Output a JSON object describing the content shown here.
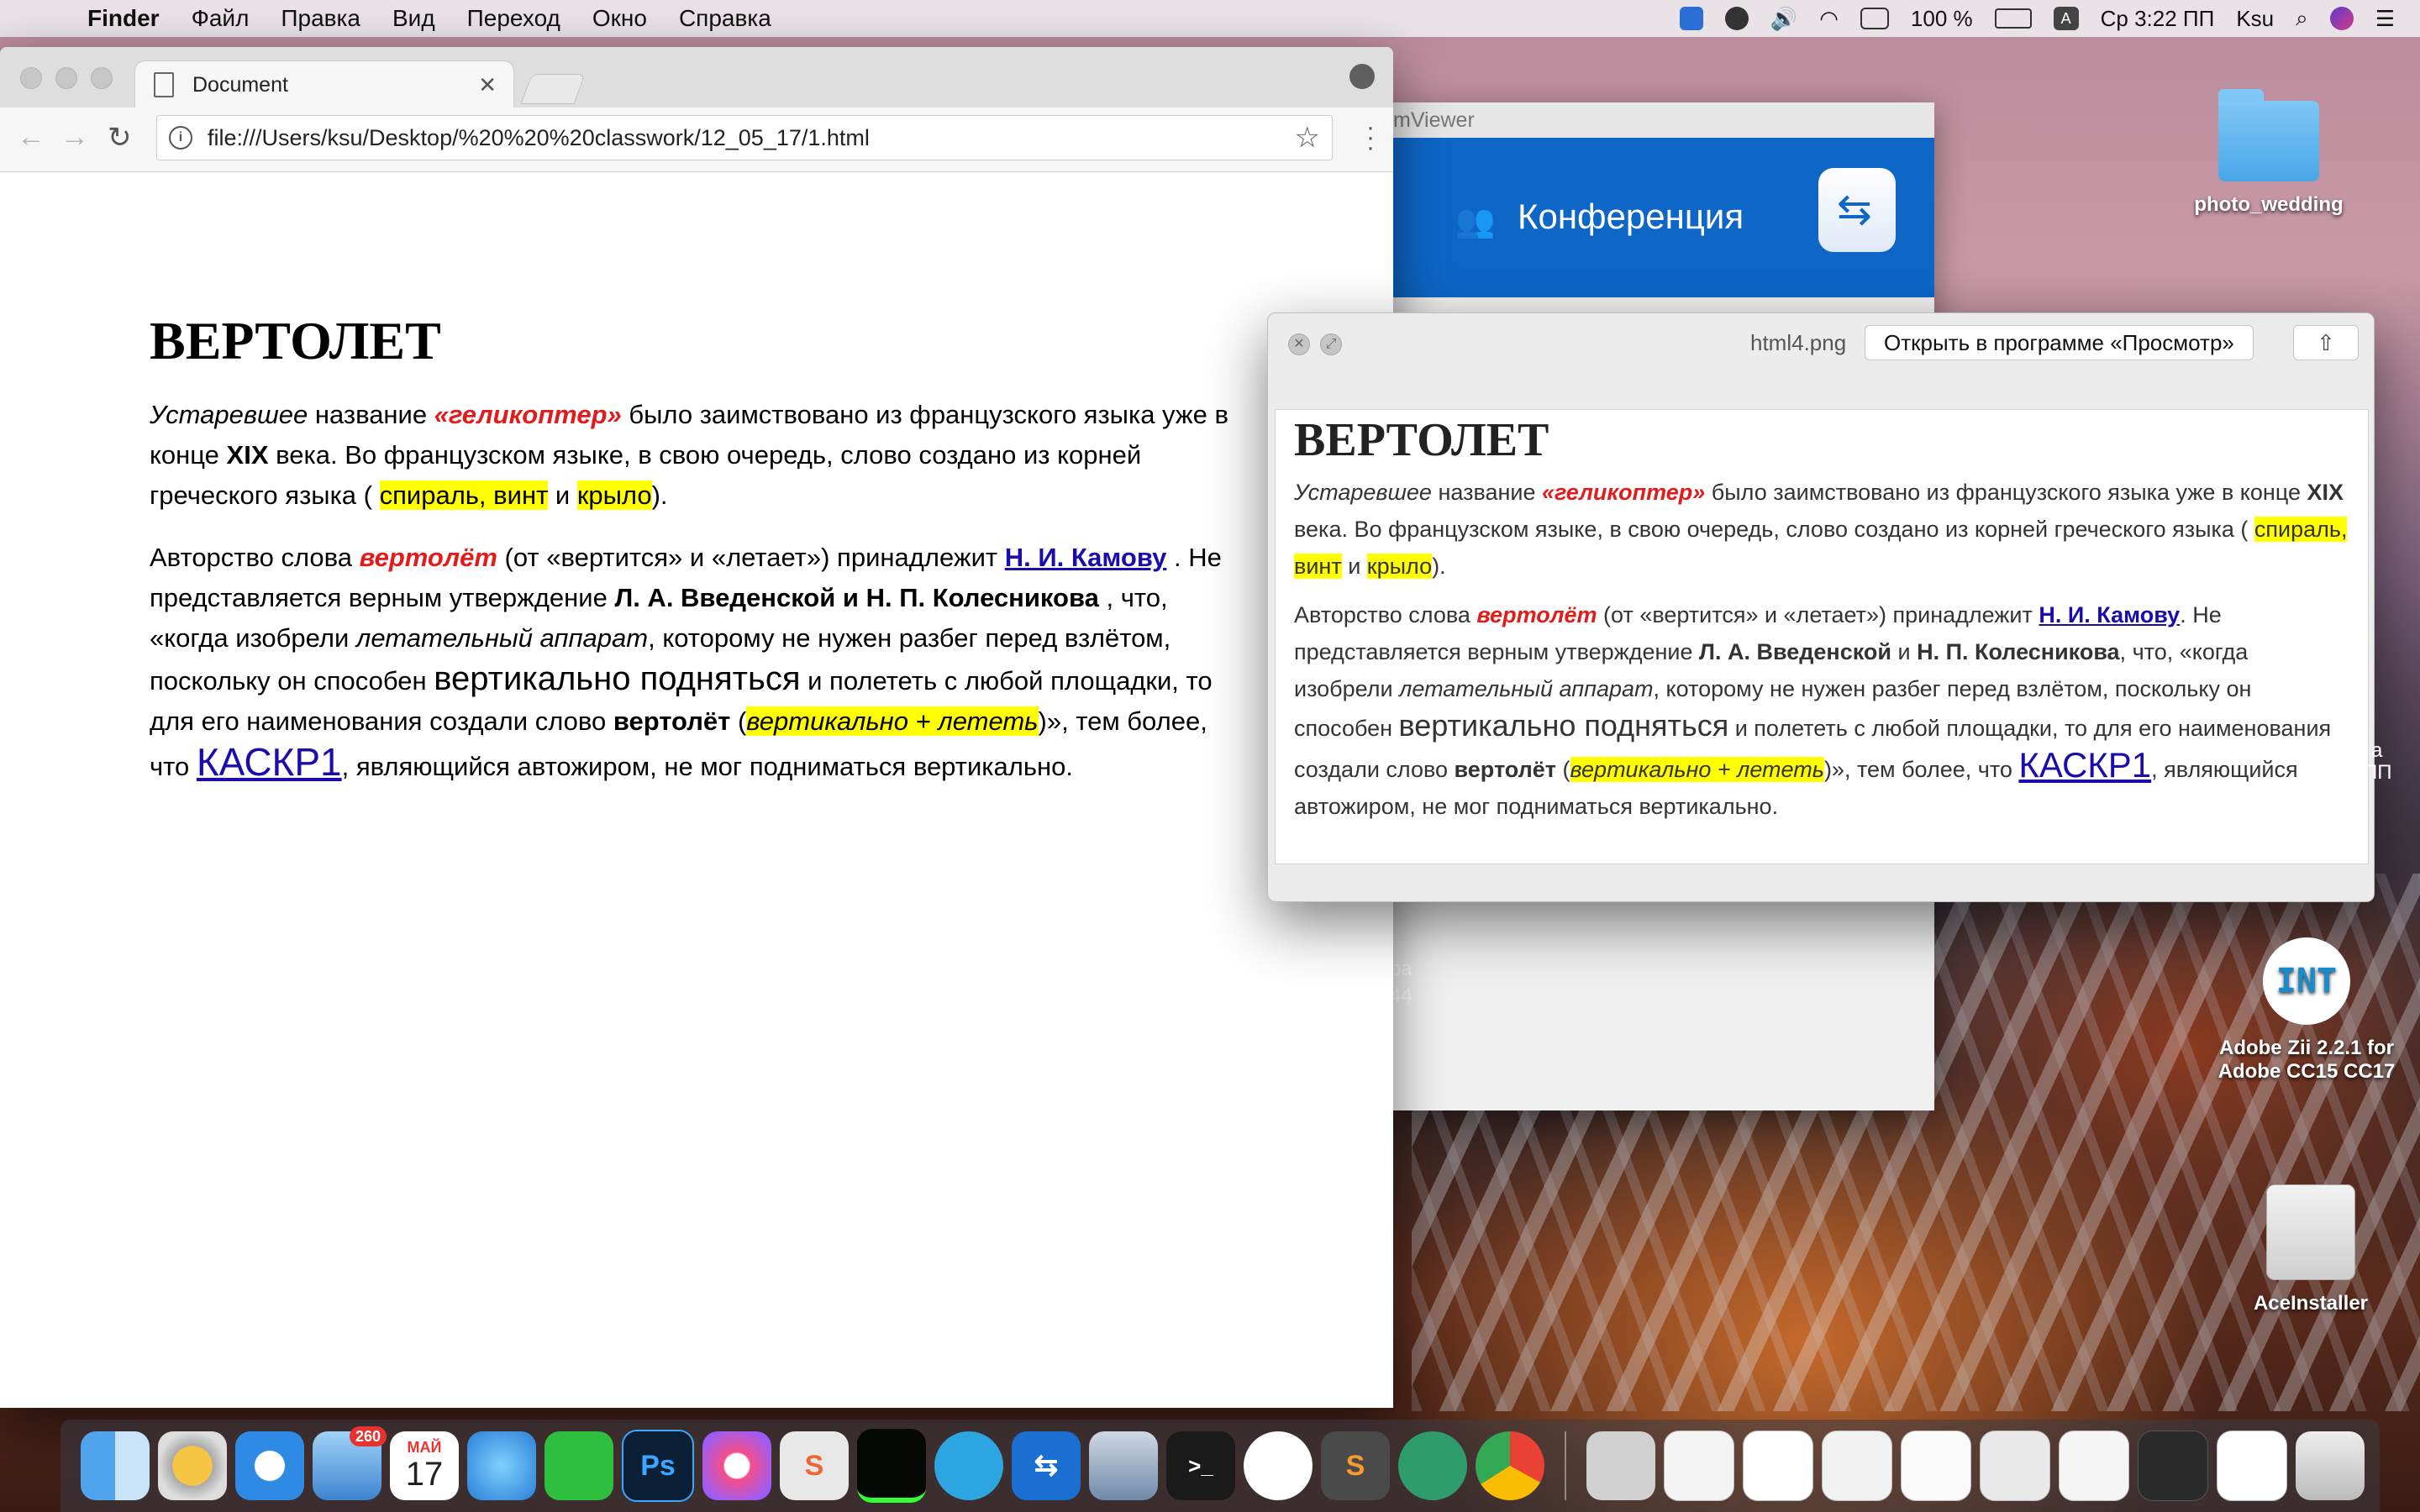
{
  "menubar": {
    "app": "Finder",
    "items": [
      "Файл",
      "Правка",
      "Вид",
      "Переход",
      "Окно",
      "Справка"
    ],
    "battery": "100 %",
    "input_source": "A",
    "clock": "Ср 3:22 ПП",
    "user": "Ksu"
  },
  "browser": {
    "tab_title": "Document",
    "url": "file:///Users/ksu/Desktop/%20%20%20classwork/12_05_17/1.html"
  },
  "article": {
    "title": "ВЕРТОЛЕТ",
    "p1": {
      "a": "Устаревшее",
      "b": " название ",
      "c": "«геликоптер»",
      "d": " было заимствовано из французского языка уже в конце ",
      "e": "XIX",
      "f": " века. Во французском языке, в свою очередь, слово создано из корней греческого языка ( ",
      "g": "спираль, винт",
      "h": " и ",
      "i": "крыло",
      "j": ")."
    },
    "p2": {
      "a": "Авторство слова ",
      "b": "вертолёт",
      "c": " (от «вертится» и «летает») принадлежит ",
      "d": "Н. И. Камову",
      "e": " . Не представляется верным утверждение ",
      "f": "Л. А. Введенской и Н. П. Колесникова",
      "g": " , что, «когда изобрели ",
      "h": "летательный аппарат",
      "i": ", которому не нужен разбег перед взлётом, поскольку он способен ",
      "j": "вертикально подняться",
      "k": " и полететь с любой площадки, то для его наименования создали слово ",
      "l": "вертолёт",
      "m": " (",
      "n": "вертикально + лететь",
      "o": ")», тем более, что ",
      "p": "КАСКР1",
      "q": ", являющийся автожиром, не мог подниматься вертикально."
    }
  },
  "teamviewer": {
    "title_fragment": "mViewer",
    "banner": "Конференция"
  },
  "quicklook": {
    "filename": "html4.png",
    "open_button": "Открыть в программе «Просмотр»",
    "title": "ВЕРТОЛЕТ",
    "p1": {
      "a": "Устаревшее",
      "b": " название ",
      "c": "«геликоптер»",
      "d": " было заимствовано из французского языка уже в конце ",
      "e": "XIX",
      "f": " века. Во французском языке, в свою очередь, слово создано из корней греческого языка ( ",
      "g": "спираль, винт",
      "h": " и ",
      "i": "крыло",
      "j": ")."
    },
    "p2": {
      "a": "Авторство слова ",
      "b": "вертолёт",
      "c": " (от «вертится» и «летает») принадлежит ",
      "d": "Н. И. Камову",
      "e": ".  Не представляется верным утверждение ",
      "f": "Л. А. Введенской",
      "g": " и ",
      "h": "Н. П. Колесникова",
      "i": ", что, «когда изобрели ",
      "j": "летательный аппарат",
      "k": ", которому не нужен разбег перед взлётом, поскольку он способен ",
      "l": "вертикально подняться",
      "m": " и полететь с любой площадки, то для его наименования создали слово ",
      "n": "вертолёт",
      "o": " (",
      "p": "вертикально + лететь",
      "q": ")», тем более, что ",
      "r": "КАСКР1",
      "s": ", являющийся автожиром, не мог подниматься вертикально."
    }
  },
  "desktop": {
    "folder": "photo_wedding",
    "app_icon_letters": "INT",
    "app_label_1": "Adobe Zii 2.2.1  for",
    "app_label_2": "Adobe CC15 CC17",
    "drive": "AceInstaller",
    "tv_fragment_1": "ра",
    "tv_fragment_2": "44",
    "edge_fragment_1": "а",
    "edge_fragment_2": "ПП"
  },
  "dock": {
    "mail_badge": "260",
    "calendar_month": "МАЙ",
    "calendar_day": "17",
    "photoshop": "Ps",
    "terminal": ">_"
  },
  "colors": {
    "highlight": "#ffff00",
    "emphasis_red": "#e41b1b",
    "link": "#1a0dab",
    "teamviewer_blue": "#0e66c7"
  }
}
